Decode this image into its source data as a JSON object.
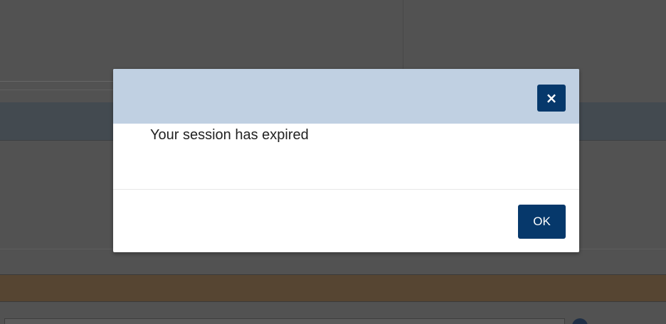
{
  "colors": {
    "overlay_bg": "#525252",
    "modal_header_bg": "#c0d0e2",
    "primary_button": "#06386b",
    "brown_bar": "#564532",
    "dark_bar": "#434a50"
  },
  "modal": {
    "close_icon": "×",
    "message": "Your session has expired",
    "ok_label": "OK"
  },
  "icons": {
    "close": "close-icon",
    "info": "info-icon"
  }
}
